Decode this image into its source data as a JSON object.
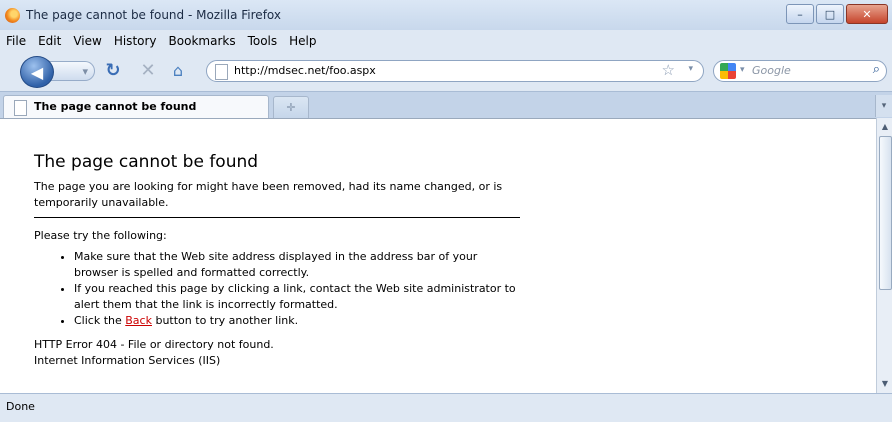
{
  "window": {
    "title": "The page cannot be found - Mozilla Firefox",
    "controls": {
      "minimize": "–",
      "maximize": "□",
      "close": "✕"
    }
  },
  "menu": [
    {
      "label": "File"
    },
    {
      "label": "Edit"
    },
    {
      "label": "View"
    },
    {
      "label": "History"
    },
    {
      "label": "Bookmarks"
    },
    {
      "label": "Tools"
    },
    {
      "label": "Help"
    }
  ],
  "nav": {
    "url": "http://mdsec.net/foo.aspx",
    "search_placeholder": "Google",
    "icons": {
      "back": "back-arrow-icon",
      "forward": "forward-arrow-icon",
      "reload": "reload-icon",
      "stop": "stop-icon",
      "home": "home-icon",
      "bookmark": "star-icon",
      "search": "magnifier-icon"
    }
  },
  "tabs": [
    {
      "label": "The page cannot be found",
      "active": true
    }
  ],
  "page": {
    "heading": "The page cannot be found",
    "intro": "The page you are looking for might have been removed, had its name changed, or is temporarily unavailable.",
    "try_label": "Please try the following:",
    "bullets": [
      "Make sure that the Web site address displayed in the address bar of your browser is spelled and formatted correctly.",
      "If you reached this page by clicking a link, contact the Web site administrator to alert them that the link is incorrectly formatted."
    ],
    "bullet3": {
      "prefix": "Click the ",
      "link": "Back",
      "suffix": " button to try another link."
    },
    "error_line": "HTTP Error 404 - File or directory not found.",
    "server_line": "Internet Information Services (IIS)"
  },
  "status": "Done"
}
